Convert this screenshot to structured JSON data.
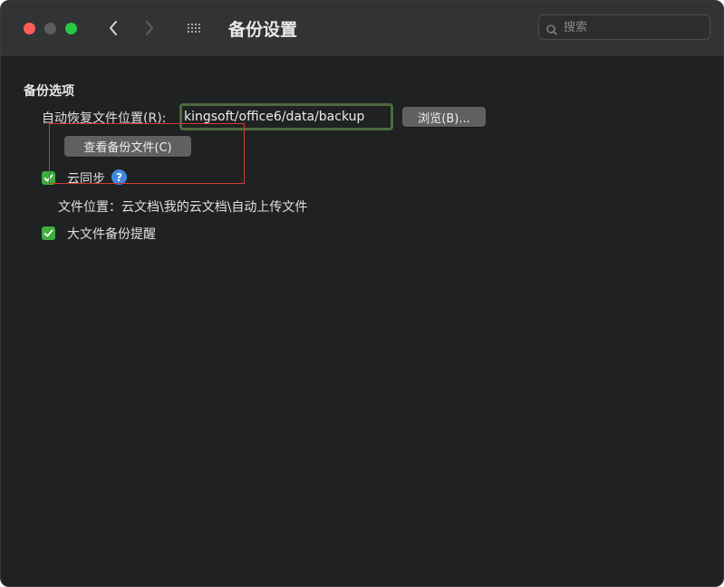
{
  "window": {
    "title": "备份设置",
    "search": {
      "placeholder": "搜索",
      "value": ""
    }
  },
  "icons": {
    "back": "chevron-left-icon",
    "forward": "chevron-right-icon",
    "grid": "grid-icon",
    "search": "search-icon",
    "help": "help-icon",
    "checkmark": "checkmark-icon"
  },
  "colors": {
    "close": "#ff5f57",
    "minimize_inactive": "#5c5d5e",
    "zoom": "#2ac840",
    "checkbox": "#3fae3f",
    "help": "#3f88e0",
    "annotation": "#d23a33",
    "field_highlight": "#4d6b3f"
  },
  "backup": {
    "section_title": "备份选项",
    "autosave_label": "自动恢复文件位置(R):",
    "autosave_path": "kingsoft/office6/data/backup",
    "browse_button": "浏览(B)...",
    "view_backup_button": "查看备份文件(C)",
    "cloud_sync": {
      "label": "云同步",
      "checked": true,
      "help_glyph": "?"
    },
    "file_location": "文件位置：云文档\\我的云文档\\自动上传文件",
    "large_file_reminder": {
      "label": "大文件备份提醒",
      "checked": true
    }
  }
}
